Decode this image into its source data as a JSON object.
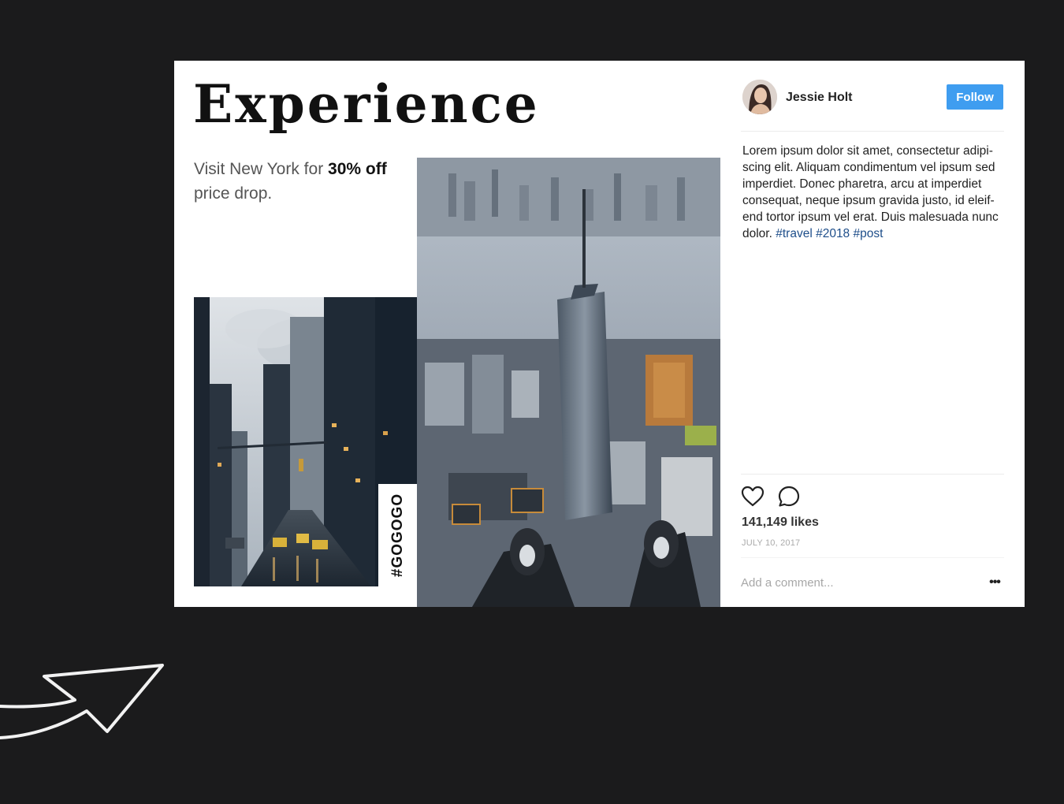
{
  "post": {
    "headline": "Experience",
    "promo_prefix": "Visit New York for ",
    "promo_bold": "30% off",
    "promo_suffix": " price drop.",
    "tag": "#GOGOGO"
  },
  "profile": {
    "username": "Jessie Holt",
    "follow_label": "Follow",
    "avatar_icon": "avatar-photo"
  },
  "caption": {
    "text": "Lorem ipsum dolor sit amet, consectetur adipi-scing elit. Aliquam condimentum vel ipsum sed imperdiet. Donec pharetra, arcu at imperdiet consequat, neque ipsum gravida justo, id eleif-end tortor ipsum vel erat. Duis malesuada nunc dolor.",
    "hashtags": [
      "#travel",
      "#2018",
      "#post"
    ]
  },
  "actions": {
    "like_icon": "heart-outline-icon",
    "comment_icon": "comment-bubble-icon",
    "likes": "141,149 likes",
    "date": "JULY 10, 2017",
    "comment_placeholder": "Add a comment...",
    "more_label": "•••"
  },
  "colors": {
    "background": "#1b1b1c",
    "card": "#ffffff",
    "follow_button": "#3f9df0",
    "hashtag": "#1e4e8a"
  }
}
